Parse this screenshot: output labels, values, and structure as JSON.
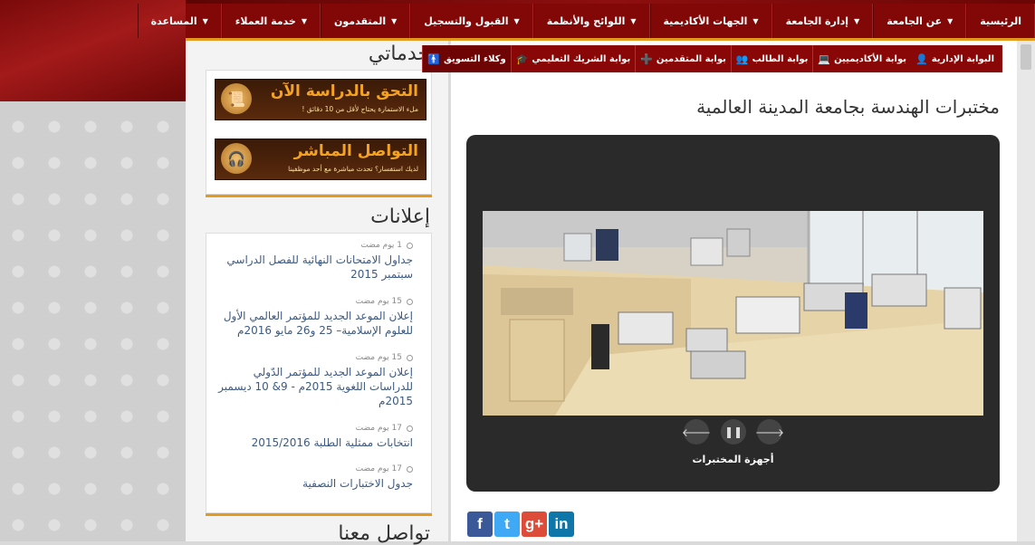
{
  "nav": {
    "items": [
      {
        "label": "الرئيسية",
        "caret": false
      },
      {
        "label": "عن الجامعة",
        "caret": true
      },
      {
        "label": "إدارة الجامعة",
        "caret": true
      },
      {
        "label": "الجهات الأكاديمية",
        "caret": true
      },
      {
        "label": "اللوائح والأنظمة",
        "caret": true
      },
      {
        "label": "القبول والتسجيل",
        "caret": true
      },
      {
        "label": "المتقدمون",
        "caret": true
      },
      {
        "label": "خدمة العملاء",
        "caret": true
      },
      {
        "label": "المساعدة",
        "caret": true
      }
    ]
  },
  "portals": [
    {
      "label": "البوابة الإدارية",
      "icon": "user-icon",
      "glyph": "👤"
    },
    {
      "label": "بوابة الأكاديميين",
      "icon": "laptop-icon",
      "glyph": "💻"
    },
    {
      "label": "بوابة الطالب",
      "icon": "group-icon",
      "glyph": "👥"
    },
    {
      "label": "بوابة المتقدمين",
      "icon": "user-plus-icon",
      "glyph": "➕"
    },
    {
      "label": "بوابة الشريك التعليمي",
      "icon": "graduation-cap-icon",
      "glyph": "🎓"
    },
    {
      "label": "وكلاء التسويق",
      "icon": "person-icon",
      "glyph": "🚹"
    }
  ],
  "page_title": "مختبرات الهندسة بجامعة المدينة العالمية",
  "slider": {
    "caption": "أجهزة المختبرات",
    "prev": "🡐",
    "pause": "❚❚",
    "next": "🡒"
  },
  "social": [
    {
      "name": "facebook",
      "glyph": "f",
      "color": "#3b5998"
    },
    {
      "name": "twitter",
      "glyph": "t",
      "color": "#3fa9f5"
    },
    {
      "name": "google-plus",
      "glyph": "g+",
      "color": "#dd4b39"
    },
    {
      "name": "linkedin",
      "glyph": "in",
      "color": "#0e76a8"
    }
  ],
  "sidebar": {
    "services_title": "خدماتي",
    "banners": [
      {
        "big": "التحق بالدراسة الآن",
        "small": "ملء الاستمارة يحتاج لأقل من 10 دقائق !",
        "icon": "scroll-icon",
        "glyph": "📜"
      },
      {
        "big": "التواصل المباشر",
        "small": "لديك استفسار؟ تحدث مباشرة مع أحد موظفينا",
        "icon": "headset-icon",
        "glyph": "🎧"
      }
    ],
    "announcements_title": "إعلانات",
    "announcements": [
      {
        "age": "1 يوم مضت",
        "title": "جداول الامتحانات النهائية للفصل الدراسي سبتمبر 2015"
      },
      {
        "age": "15 يوم مضت",
        "title": "إعلان الموعد الجديد للمؤتمر العالمي الأول للعلوم الإسلامية– 25 و26 مايو 2016م"
      },
      {
        "age": "15 يوم مضت",
        "title": "إعلان الموعد الجديد للمؤتمر الدّولي للدراسات اللغوية 2015م - 9& 10 ديسمبر 2015م"
      },
      {
        "age": "17 يوم مضت",
        "title": "انتخابات ممثلية الطلبة 2015/2016"
      },
      {
        "age": "17 يوم مضت",
        "title": "جدول الاختبارات النصفية"
      }
    ],
    "contact_title": "تواصل معنا"
  }
}
